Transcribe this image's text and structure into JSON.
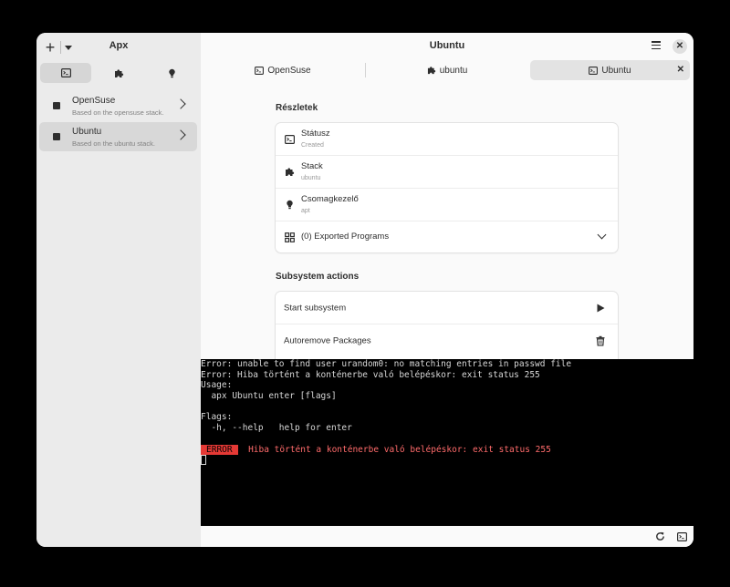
{
  "sidebar": {
    "title": "Apx",
    "add_icon": "plus-icon",
    "tabs": [
      {
        "icon": "terminal-icon",
        "active": true
      },
      {
        "icon": "puzzle-icon",
        "active": false
      },
      {
        "icon": "bulb-icon",
        "active": false
      }
    ],
    "items": [
      {
        "name": "OpenSuse",
        "description": "Based on the opensuse stack.",
        "selected": false
      },
      {
        "name": "Ubuntu",
        "description": "Based on the ubuntu stack.",
        "selected": true
      }
    ]
  },
  "header": {
    "title": "Ubuntu",
    "menu_icon": "hamburger-icon",
    "close_icon": "close-icon"
  },
  "tabs": [
    {
      "label": "OpenSuse",
      "icon": "terminal-icon",
      "active": false
    },
    {
      "label": "ubuntu",
      "icon": "puzzle-icon",
      "active": false
    },
    {
      "label": "Ubuntu",
      "icon": "terminal-icon",
      "active": true,
      "closable": true
    }
  ],
  "details": {
    "title": "Részletek",
    "rows": [
      {
        "label": "Státusz",
        "value": "Created",
        "icon": "terminal-icon"
      },
      {
        "label": "Stack",
        "value": "ubuntu",
        "icon": "puzzle-icon"
      },
      {
        "label": "Csomagkezelő",
        "value": "apt",
        "icon": "bulb-icon"
      }
    ],
    "exported": {
      "label": "(0) Exported Programs",
      "icon": "grid-icon"
    }
  },
  "actions": {
    "title": "Subsystem actions",
    "items": [
      {
        "label": "Start subsystem",
        "icon": "play-icon"
      },
      {
        "label": "Autoremove Packages",
        "icon": "trash-icon"
      }
    ]
  },
  "terminal": {
    "lines": [
      "Error: unable to find user urandom0: no matching entries in passwd file",
      "Error: Hiba történt a konténerbe való belépéskor: exit status 255",
      "Usage:",
      "  apx Ubuntu enter [flags]",
      "",
      "Flags:",
      "  -h, --help   help for enter",
      ""
    ],
    "error_badge": "ERROR",
    "error_message": "Hiba történt a konténerbe való belépéskor: exit status 255",
    "colors": {
      "background": "#000000",
      "text": "#d8d8d8",
      "error_badge": "#e53935",
      "error_text": "#ff6b6b"
    }
  },
  "bottom_bar": {
    "icons": [
      "refresh-icon",
      "terminal-icon"
    ]
  }
}
